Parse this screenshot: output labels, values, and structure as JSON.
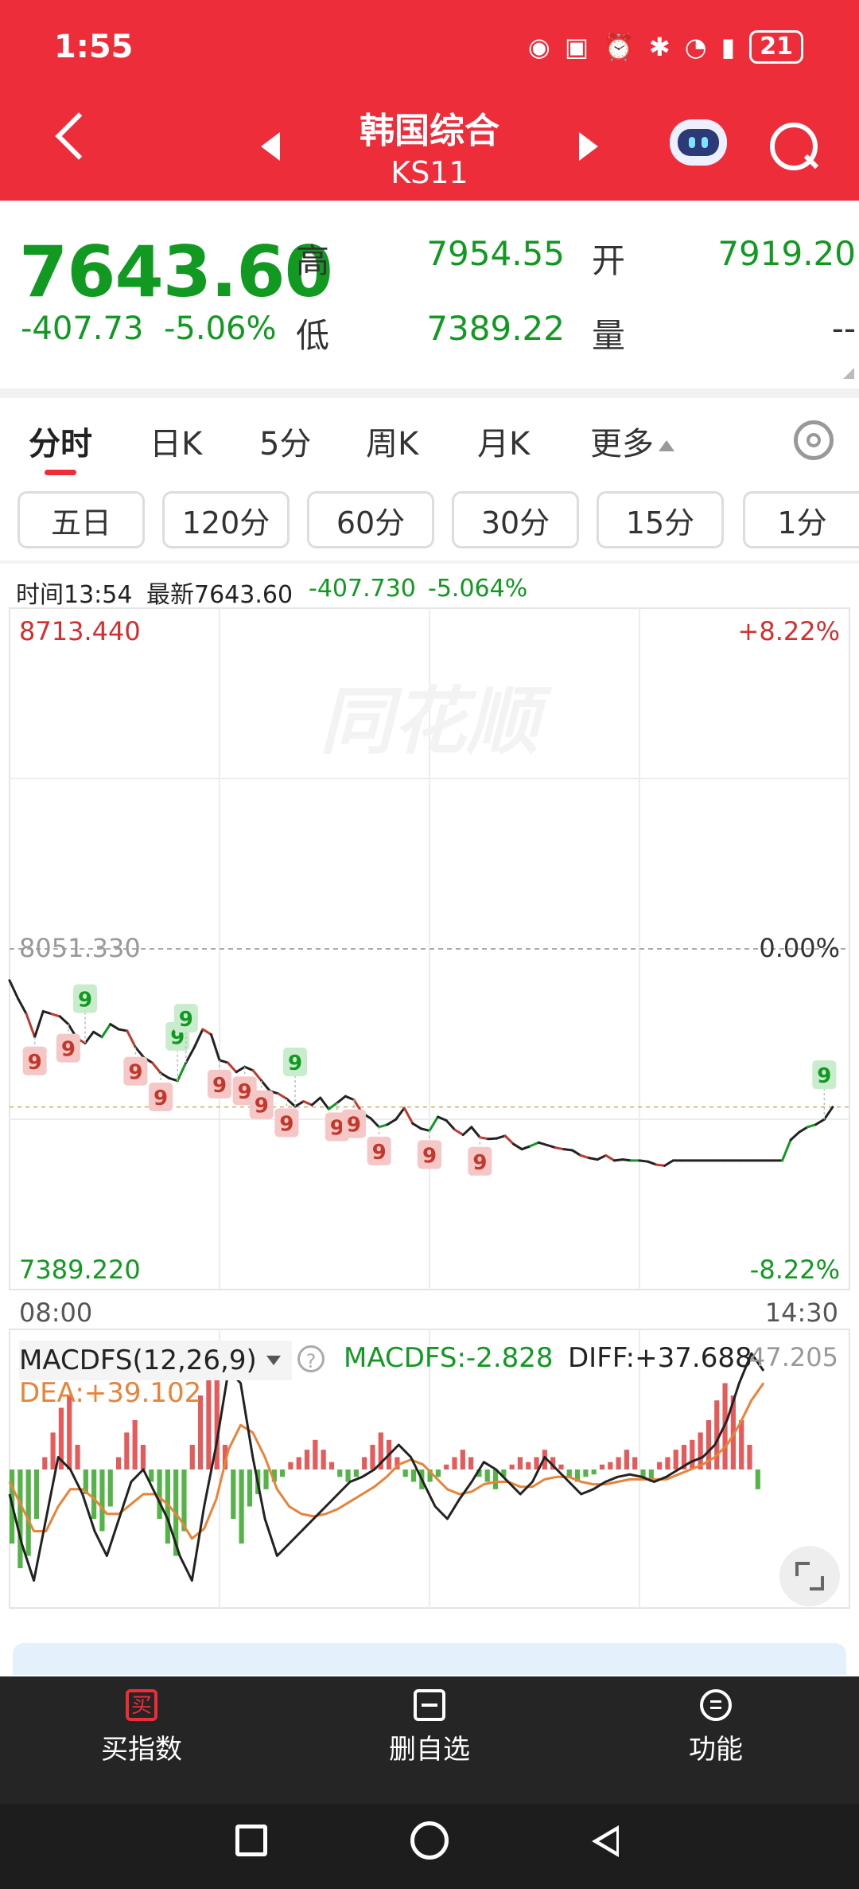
{
  "status_bar": {
    "time": "1:55",
    "battery": "21"
  },
  "header": {
    "title": "韩国综合",
    "code": "KS11"
  },
  "quote": {
    "price": "7643.60",
    "change": "-407.73",
    "change_pct": "-5.06%",
    "high_label": "高",
    "high": "7954.55",
    "low_label": "低",
    "low": "7389.22",
    "open_label": "开",
    "open": "7919.20",
    "volume_label": "量",
    "volume": "--"
  },
  "tabs": [
    "分时",
    "日K",
    "5分",
    "周K",
    "月K",
    "更多"
  ],
  "period_buttons": [
    "五日",
    "120分",
    "60分",
    "30分",
    "15分",
    "1分"
  ],
  "info_line": {
    "time_label": "时间13:54",
    "latest_label": "最新7643.60",
    "change": "-407.730",
    "change_pct": "-5.064%"
  },
  "chart_data": {
    "type": "line",
    "title": "",
    "price_axis": {
      "max": 8713.44,
      "max_label": "8713.440",
      "max_pct": "+8.22%",
      "prev_close": 8051.33,
      "prev_close_label": "8051.330",
      "zero_pct": "0.00%",
      "min": 7389.22,
      "min_label": "7389.220",
      "min_pct": "-8.22%"
    },
    "time_axis": {
      "start": "08:00",
      "end": "14:30"
    },
    "watermark": "同花顺",
    "series": [
      {
        "x": [
          0,
          0.01,
          0.02,
          0.03,
          0.04,
          0.05,
          0.06,
          0.07,
          0.08,
          0.09,
          0.1,
          0.11,
          0.12,
          0.13,
          0.14,
          0.15,
          0.16,
          0.17,
          0.18,
          0.19,
          0.2,
          0.21,
          0.22,
          0.23,
          0.24,
          0.25,
          0.26,
          0.27,
          0.28,
          0.29,
          0.3,
          0.31,
          0.32,
          0.33,
          0.34,
          0.35,
          0.36,
          0.37,
          0.38,
          0.39,
          0.4,
          0.41,
          0.42,
          0.43,
          0.44,
          0.45,
          0.46,
          0.47,
          0.48,
          0.49,
          0.5,
          0.51,
          0.52,
          0.53,
          0.54,
          0.55,
          0.56,
          0.57,
          0.58,
          0.59,
          0.6,
          0.61,
          0.62,
          0.63,
          0.64,
          0.65,
          0.66,
          0.67,
          0.68,
          0.69,
          0.7,
          0.71,
          0.72,
          0.73,
          0.74,
          0.75,
          0.76,
          0.77,
          0.78,
          0.79,
          0.8,
          0.81,
          0.82,
          0.83,
          0.84,
          0.85,
          0.86,
          0.87,
          0.88,
          0.89,
          0.9,
          0.91,
          0.92,
          0.93,
          0.94,
          0.95,
          0.96,
          0.97,
          0.98
        ],
        "values": [
          7990,
          7955,
          7925,
          7880,
          7930,
          7925,
          7920,
          7905,
          7878,
          7868,
          7890,
          7880,
          7905,
          7895,
          7892,
          7860,
          7840,
          7830,
          7810,
          7800,
          7795,
          7830,
          7860,
          7895,
          7885,
          7835,
          7830,
          7812,
          7822,
          7815,
          7795,
          7775,
          7770,
          7760,
          7745,
          7755,
          7748,
          7762,
          7740,
          7752,
          7765,
          7758,
          7732,
          7722,
          7705,
          7710,
          7720,
          7742,
          7712,
          7702,
          7698,
          7725,
          7718,
          7700,
          7690,
          7705,
          7685,
          7682,
          7683,
          7688,
          7672,
          7662,
          7668,
          7675,
          7670,
          7665,
          7662,
          7660,
          7650,
          7645,
          7642,
          7650,
          7640,
          7642,
          7640,
          7640,
          7638,
          7632,
          7630,
          7640,
          7640,
          7640,
          7640,
          7640,
          7640,
          7640,
          7640,
          7640,
          7640,
          7640,
          7640,
          7640,
          7640,
          7680,
          7695,
          7705,
          7710,
          7720,
          7744
        ],
        "ylim": [
          7389.22,
          8713.44
        ]
      }
    ],
    "signal_markers": [
      {
        "label": "9",
        "color": "red"
      },
      {
        "label": "9",
        "color": "red"
      },
      {
        "label": "9",
        "color": "green"
      },
      {
        "label": "9",
        "color": "red"
      },
      {
        "label": "9",
        "color": "red"
      },
      {
        "label": "9",
        "color": "green"
      },
      {
        "label": "9",
        "color": "green"
      },
      {
        "label": "9",
        "color": "red"
      },
      {
        "label": "9",
        "color": "red"
      },
      {
        "label": "9",
        "color": "red"
      },
      {
        "label": "9",
        "color": "red"
      },
      {
        "label": "9",
        "color": "green"
      },
      {
        "label": "9",
        "color": "red"
      },
      {
        "label": "9",
        "color": "red"
      },
      {
        "label": "9",
        "color": "red"
      },
      {
        "label": "9",
        "color": "red"
      },
      {
        "label": "9",
        "color": "red"
      },
      {
        "label": "9",
        "color": "green"
      }
    ],
    "macd": {
      "label": "MACDFS(12,26,9)",
      "macdfs_text": "MACDFS:-2.828",
      "diff_text": "DIFF:+37.688",
      "dea_text": "DEA:+39.102",
      "scale_label": "47.205",
      "histogram": [
        -30,
        -40,
        -35,
        -20,
        5,
        15,
        25,
        30,
        10,
        -10,
        -20,
        -25,
        -15,
        5,
        15,
        20,
        10,
        -5,
        -20,
        -30,
        -35,
        -25,
        10,
        30,
        45,
        40,
        10,
        -20,
        -30,
        -15,
        -10,
        -8,
        -5,
        -3,
        3,
        5,
        8,
        12,
        8,
        3,
        -3,
        -5,
        -3,
        5,
        10,
        15,
        12,
        5,
        -3,
        -5,
        -8,
        -5,
        -3,
        2,
        5,
        8,
        5,
        -3,
        -5,
        -8,
        -3,
        2,
        5,
        3,
        5,
        8,
        5,
        2,
        -3,
        -5,
        -3,
        -2,
        2,
        3,
        5,
        8,
        5,
        -3,
        -5,
        3,
        5,
        8,
        10,
        12,
        15,
        20,
        28,
        35,
        30,
        20,
        10,
        -8
      ],
      "diff": [
        -10,
        -30,
        -45,
        -20,
        5,
        0,
        -10,
        -25,
        -35,
        -20,
        -5,
        0,
        -10,
        -20,
        -35,
        -45,
        -15,
        10,
        40,
        35,
        5,
        -20,
        -35,
        -30,
        -25,
        -20,
        -15,
        -10,
        -5,
        -3,
        0,
        5,
        10,
        5,
        -5,
        -15,
        -20,
        -12,
        -5,
        3,
        0,
        -5,
        -10,
        -5,
        5,
        0,
        -5,
        -10,
        -8,
        -5,
        -3,
        -2,
        -3,
        -5,
        -3,
        0,
        3,
        5,
        10,
        20,
        35,
        47,
        40
      ],
      "dea": [
        -5,
        -15,
        -25,
        -25,
        -15,
        -8,
        -8,
        -12,
        -18,
        -18,
        -14,
        -10,
        -10,
        -14,
        -20,
        -28,
        -24,
        -12,
        8,
        18,
        15,
        5,
        -8,
        -15,
        -18,
        -19,
        -18,
        -16,
        -13,
        -10,
        -7,
        -3,
        2,
        4,
        2,
        -3,
        -8,
        -10,
        -9,
        -6,
        -5,
        -5,
        -7,
        -7,
        -4,
        -3,
        -3,
        -5,
        -6,
        -6,
        -5,
        -4,
        -4,
        -4,
        -4,
        -2,
        0,
        2,
        5,
        10,
        18,
        28,
        35
      ]
    }
  },
  "bottom_bar": {
    "buy_label": "买指数",
    "buy_icon_text": "买",
    "remove_label": "删自选",
    "function_label": "功能"
  }
}
